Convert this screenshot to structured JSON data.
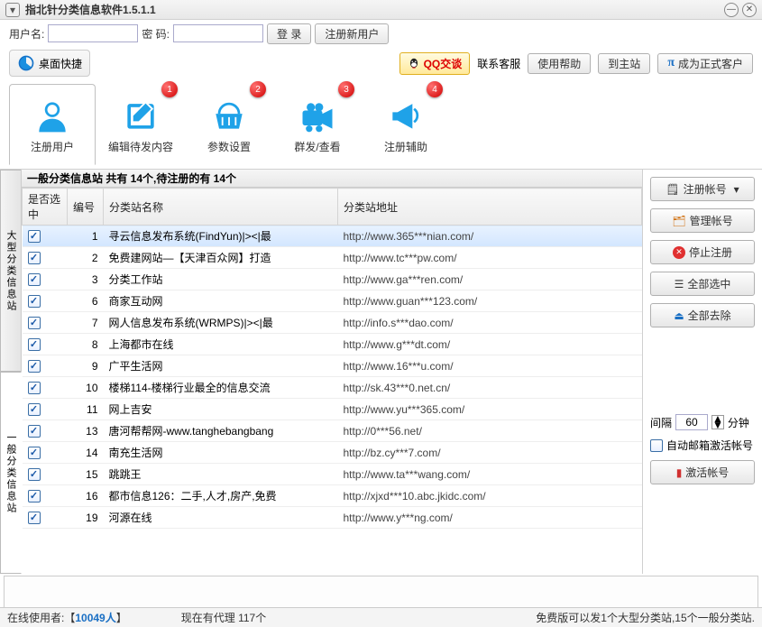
{
  "title": "指北针分类信息软件1.5.1.1",
  "login": {
    "username_label": "用户名:",
    "password_label": "密   码:",
    "login_btn": "登 录",
    "register_btn": "注册新用户"
  },
  "links": {
    "desktop_shortcut": "桌面快捷",
    "qq_btn": "QQ交谈",
    "contact": "联系客服",
    "help_btn": "使用帮助",
    "tosite_btn": "到主站",
    "official_btn": "成为正式客户"
  },
  "bigtabs": [
    {
      "label": "注册用户",
      "badge": ""
    },
    {
      "label": "编辑待发内容",
      "badge": "1"
    },
    {
      "label": "参数设置",
      "badge": "2"
    },
    {
      "label": "群发/查看",
      "badge": "3"
    },
    {
      "label": "注册辅助",
      "badge": "4"
    }
  ],
  "vtabs": {
    "big": "大型分类信息站",
    "normal": "一般分类信息站"
  },
  "table": {
    "header_summary": "一般分类信息站 共有 14个,待注册的有 14个",
    "columns": {
      "chk": "是否选中",
      "num": "编号",
      "name": "分类站名称",
      "url": "分类站地址"
    },
    "rows": [
      {
        "chk": true,
        "num": 1,
        "name": "寻云信息发布系统(FindYun)|><|最",
        "url": "http://www.365***nian.com/",
        "sel": true
      },
      {
        "chk": true,
        "num": 2,
        "name": "免费建网站—【天津百众网】打造",
        "url": "http://www.tc***pw.com/"
      },
      {
        "chk": true,
        "num": 3,
        "name": "分类工作站",
        "url": "http://www.ga***ren.com/"
      },
      {
        "chk": true,
        "num": 6,
        "name": "商家互动网",
        "url": "http://www.guan***123.com/"
      },
      {
        "chk": true,
        "num": 7,
        "name": "网人信息发布系统(WRMPS)|><|最",
        "url": "http://info.s***dao.com/"
      },
      {
        "chk": true,
        "num": 8,
        "name": "上海都市在线",
        "url": "http://www.g***dt.com/"
      },
      {
        "chk": true,
        "num": 9,
        "name": "广平生活网",
        "url": "http://www.16***u.com/"
      },
      {
        "chk": true,
        "num": 10,
        "name": "楼梯114-楼梯行业最全的信息交流",
        "url": "http://sk.43***0.net.cn/"
      },
      {
        "chk": true,
        "num": 11,
        "name": "网上吉安",
        "url": "http://www.yu***365.com/"
      },
      {
        "chk": true,
        "num": 13,
        "name": "唐河帮帮网-www.tanghebangbang",
        "url": "http://0***56.net/"
      },
      {
        "chk": true,
        "num": 14,
        "name": "南充生活网",
        "url": "http://bz.cy***7.com/"
      },
      {
        "chk": true,
        "num": 15,
        "name": "跳跳王",
        "url": "http://www.ta***wang.com/"
      },
      {
        "chk": true,
        "num": 16,
        "name": "都市信息126：二手,人才,房产,免费",
        "url": "http://xjxd***10.abc.jkidc.com/"
      },
      {
        "chk": true,
        "num": 19,
        "name": "河源在线",
        "url": "http://www.y***ng.com/"
      }
    ]
  },
  "right": {
    "reg_account": "注册帐号",
    "manage_account": "管理帐号",
    "stop_reg": "停止注册",
    "select_all": "全部选中",
    "remove_all": "全部去除",
    "interval_label": "间隔",
    "interval_value": "60",
    "minutes": "分钟",
    "auto_activate": "自动邮箱激活帐号",
    "activate_btn": "激活帐号"
  },
  "status": {
    "online_prefix": "在线使用者:【",
    "online_count": "10049人",
    "online_suffix": "】",
    "proxy": "现在有代理 117个",
    "freever": "免费版可以发1个大型分类站,15个一般分类站."
  }
}
